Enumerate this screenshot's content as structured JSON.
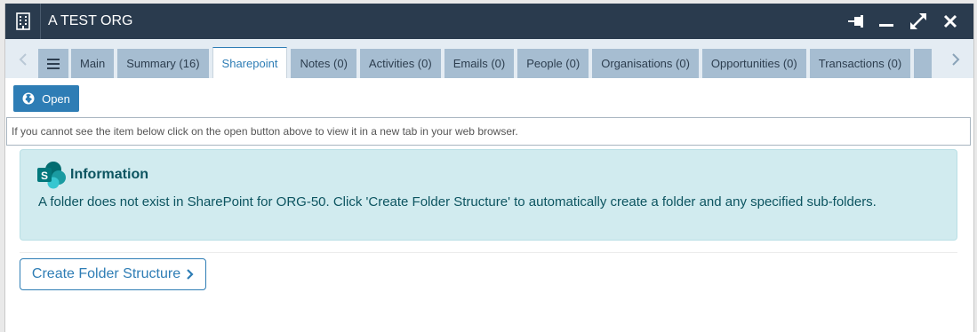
{
  "window": {
    "title": "A TEST ORG",
    "icons": {
      "org": "building-icon",
      "pin": "pin-icon",
      "minimize": "minimize-icon",
      "maximize": "expand-icon",
      "close": "close-icon"
    }
  },
  "tabs": [
    {
      "label": "Main",
      "active": false
    },
    {
      "label": "Summary (16)",
      "active": false
    },
    {
      "label": "Sharepoint",
      "active": true
    },
    {
      "label": "Notes (0)",
      "active": false
    },
    {
      "label": "Activities (0)",
      "active": false
    },
    {
      "label": "Emails (0)",
      "active": false
    },
    {
      "label": "People (0)",
      "active": false
    },
    {
      "label": "Organisations (0)",
      "active": false
    },
    {
      "label": "Opportunities (0)",
      "active": false
    },
    {
      "label": "Transactions (0)",
      "active": false
    }
  ],
  "toolbar": {
    "open_label": "Open",
    "open_icon": "globe-icon"
  },
  "hint_text": "If you cannot see the item below click on the open button above to view it in a new tab in your web browser.",
  "info": {
    "title": "Information",
    "icon": "sharepoint-icon",
    "message": "A folder does not exist in SharePoint for ORG-50. Click 'Create Folder Structure' to automatically create a folder and any specified sub-folders."
  },
  "create_button": {
    "label": "Create Folder Structure",
    "icon": "chevron-right-icon"
  },
  "colors": {
    "titlebar": "#2a3b4e",
    "accent": "#2e7db5",
    "tab": "#a6bdd1",
    "info_bg": "#d1ebef",
    "info_text": "#0c5460"
  }
}
